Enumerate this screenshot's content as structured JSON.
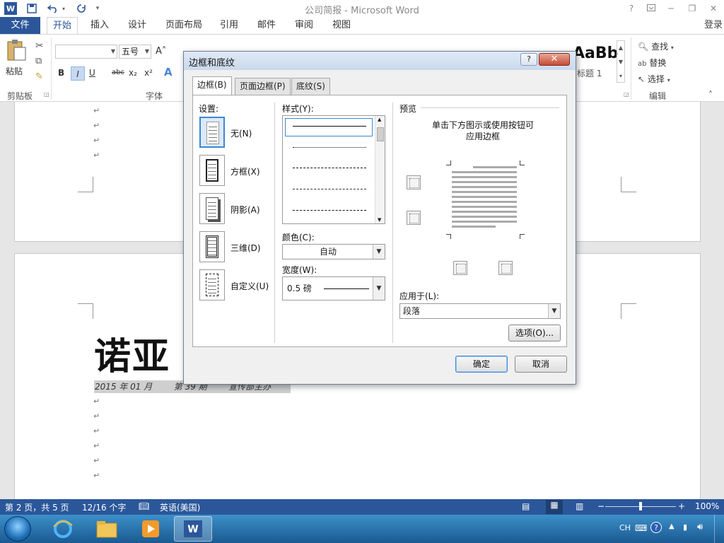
{
  "titlebar": {
    "app_title": "公司简报 - Microsoft Word",
    "help": "?",
    "word_icon": "W"
  },
  "ribbon_tabs": {
    "file": "文件",
    "tabs": [
      "开始",
      "插入",
      "设计",
      "页面布局",
      "引用",
      "邮件",
      "审阅",
      "视图"
    ],
    "active_index": 0,
    "login": "登录"
  },
  "ribbon": {
    "paste": "粘贴",
    "clipboard_group": "剪贴板",
    "font_group": "字体",
    "edit_group": "编辑",
    "font_size": "五号",
    "find": "查找",
    "replace": "替换",
    "select": "选择",
    "style_preview": "AaBb",
    "style_name": "标题 1",
    "format_bold": "B",
    "format_italic": "I",
    "format_underline": "U",
    "format_strike": "abc",
    "format_sub": "x₂",
    "format_sup": "x²"
  },
  "document": {
    "heading": "诺亚",
    "subline": "2015 年 01 月        第 39 期        宣传部主办"
  },
  "statusbar": {
    "page": "第 2 页，共 5 页",
    "words": "12/16 个字",
    "language": "英语(美国)",
    "zoom": "100%",
    "zoom_value": 100
  },
  "taskbar": {
    "tray_lang": "CH"
  },
  "dialog": {
    "title": "边框和底纹",
    "help": "?",
    "close": "✕",
    "tabs": [
      "边框(B)",
      "页面边框(P)",
      "底纹(S)"
    ],
    "active_tab": 0,
    "settings_label": "设置:",
    "settings": [
      "无(N)",
      "方框(X)",
      "阴影(A)",
      "三维(D)",
      "自定义(U)"
    ],
    "selected_setting": 0,
    "style_label": "样式(Y):",
    "color_label": "颜色(C):",
    "color_value": "自动",
    "width_label": "宽度(W):",
    "width_value": "0.5 磅",
    "preview_label": "预览",
    "preview_hint_1": "单击下方图示或使用按钮可",
    "preview_hint_2": "应用边框",
    "apply_label": "应用于(L):",
    "apply_value": "段落",
    "options_button": "选项(O)...",
    "ok_button": "确定",
    "cancel_button": "取消"
  }
}
